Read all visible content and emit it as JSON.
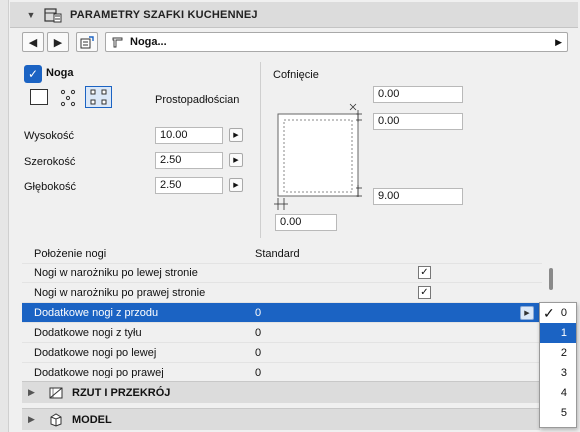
{
  "header": {
    "title": "PARAMETRY SZAFKI KUCHENNEJ"
  },
  "nav": {
    "name": "Noga..."
  },
  "leg": {
    "checkbox_label": "Noga",
    "shape_label": "Prostopadłościan"
  },
  "dims": [
    {
      "label": "Wysokość",
      "value": "10.00"
    },
    {
      "label": "Szerokość",
      "value": "2.50"
    },
    {
      "label": "Głębokość",
      "value": "2.50"
    }
  ],
  "setback": {
    "title": "Cofnięcie",
    "top1": "0.00",
    "top2": "0.00",
    "right": "9.00",
    "bottom": "0.00"
  },
  "list": {
    "rows": [
      {
        "label": "Położenie nogi",
        "value": "Standard"
      },
      {
        "label": "Nogi w narożniku po lewej stronie",
        "checked": "✓"
      },
      {
        "label": "Nogi w narożniku po prawej stronie",
        "checked": "✓"
      },
      {
        "label": "Dodatkowe nogi z przodu",
        "value": "0"
      },
      {
        "label": "Dodatkowe nogi z tyłu",
        "value": "0"
      },
      {
        "label": "Dodatkowe nogi po lewej",
        "value": "0"
      },
      {
        "label": "Dodatkowe nogi po prawej",
        "value": "0"
      }
    ]
  },
  "dropdown": {
    "options": [
      "0",
      "1",
      "2",
      "3",
      "4",
      "5"
    ],
    "checked": "0",
    "highlighted": "1"
  },
  "sections": [
    {
      "title": "RZUT I PRZEKRÓJ"
    },
    {
      "title": "MODEL"
    }
  ],
  "colors": {
    "accent": "#1b63c3"
  }
}
